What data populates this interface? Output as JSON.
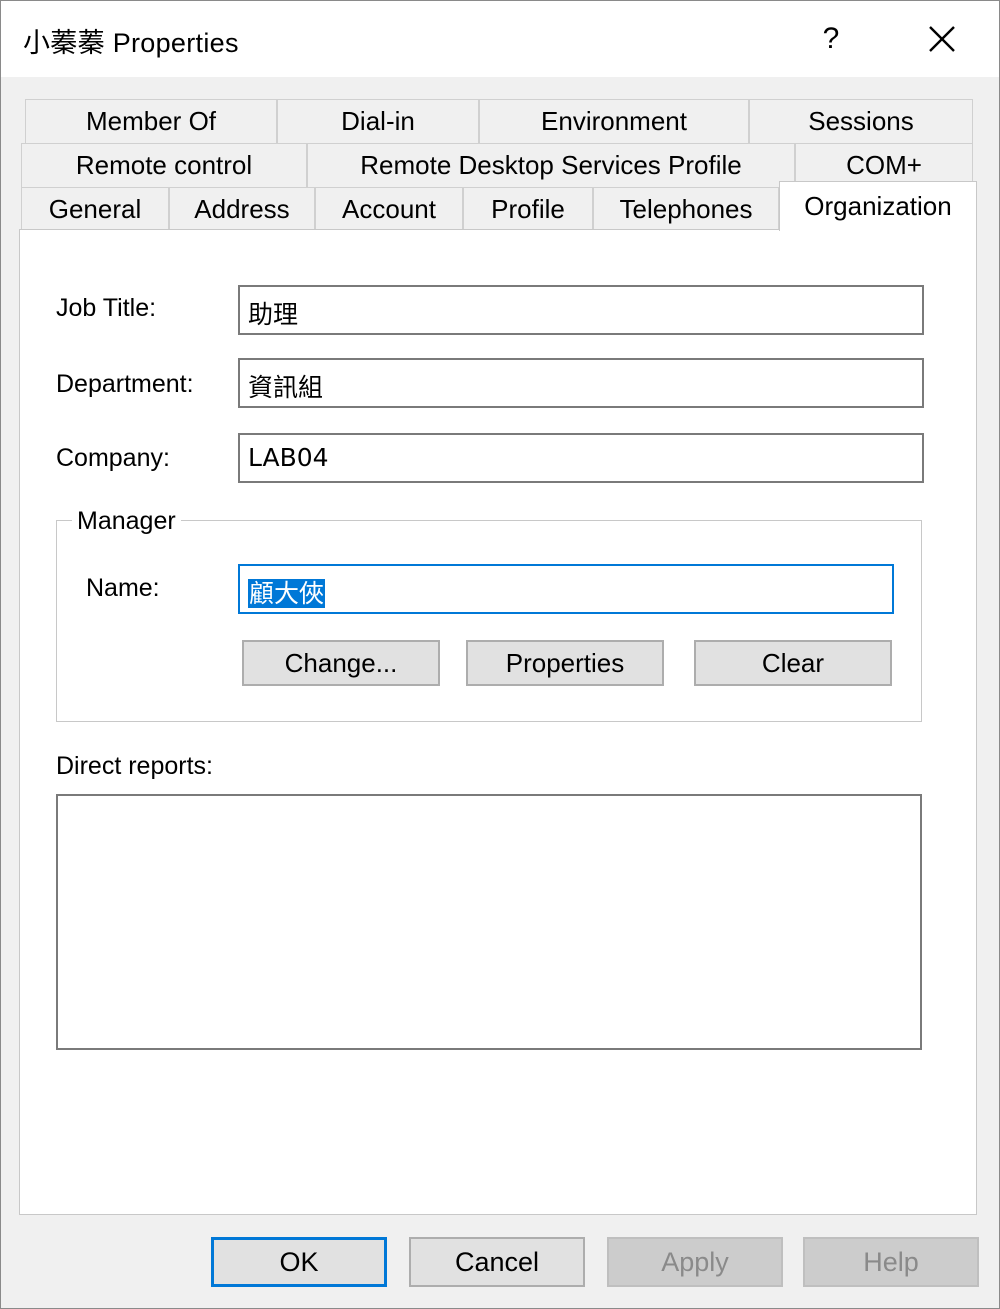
{
  "window": {
    "title": "小蓁蓁 Properties",
    "help_label": "?"
  },
  "tabs": {
    "row1": [
      "Member Of",
      "Dial-in",
      "Environment",
      "Sessions"
    ],
    "row2": [
      "Remote control",
      "Remote Desktop Services Profile",
      "COM+"
    ],
    "row3": [
      "General",
      "Address",
      "Account",
      "Profile",
      "Telephones",
      "Organization"
    ],
    "active": "Organization"
  },
  "organization": {
    "job_title": {
      "label": "Job Title:",
      "value": "助理"
    },
    "department": {
      "label": "Department:",
      "value": "資訊組"
    },
    "company": {
      "label": "Company:",
      "value": "LAB04"
    },
    "manager": {
      "group_label": "Manager",
      "name_label": "Name:",
      "name_value": "顧大俠",
      "change_label": "Change...",
      "properties_label": "Properties",
      "clear_label": "Clear"
    },
    "direct_reports_label": "Direct reports:",
    "direct_reports": []
  },
  "footer": {
    "ok": "OK",
    "cancel": "Cancel",
    "apply": "Apply",
    "help": "Help"
  },
  "colors": {
    "accent": "#0078d7",
    "dialog_bg": "#f0f0f0",
    "button_bg": "#e1e1e1"
  }
}
